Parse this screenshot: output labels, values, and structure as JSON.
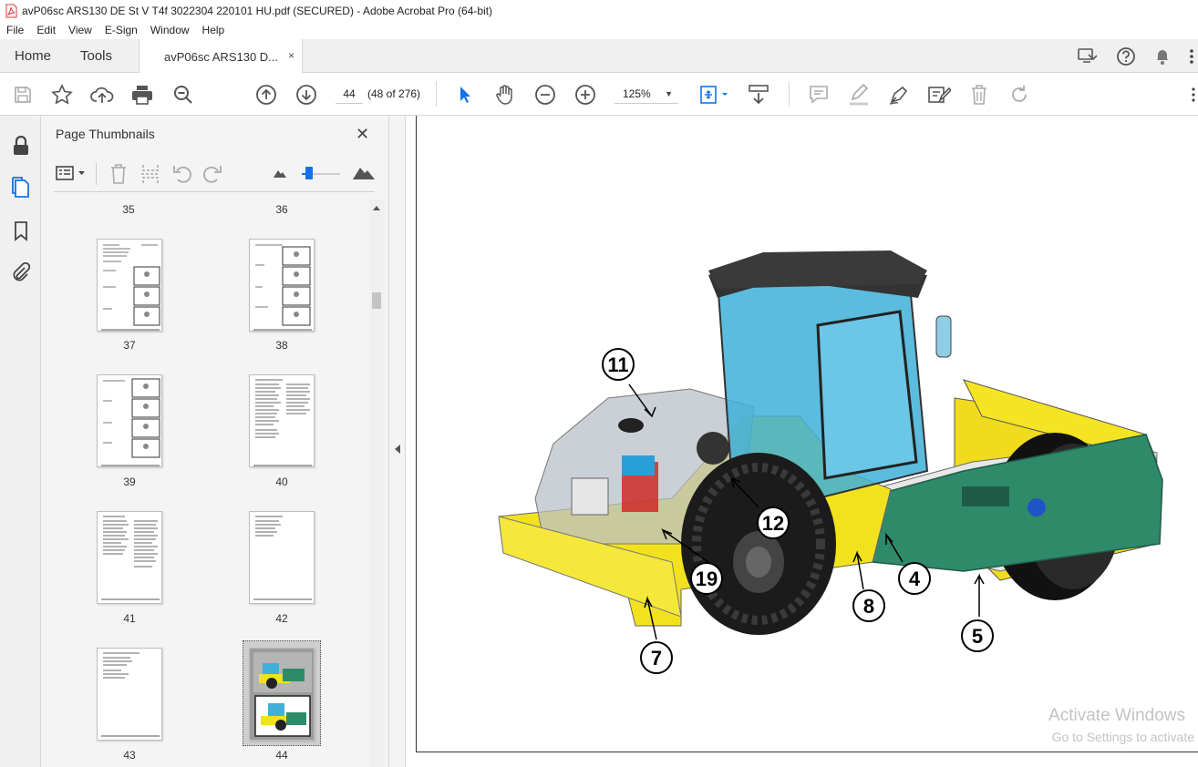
{
  "window": {
    "title": "avP06sc ARS130 DE St V T4f 3022304 220101 HU.pdf (SECURED) - Adobe Acrobat Pro (64-bit)"
  },
  "menu": [
    "File",
    "Edit",
    "View",
    "E-Sign",
    "Window",
    "Help"
  ],
  "tabs": {
    "home": "Home",
    "tools": "Tools",
    "doc": "avP06sc ARS130 D...",
    "close": "×"
  },
  "toolbar": {
    "page_number": "44",
    "page_count": "(48 of 276)",
    "zoom": "125%"
  },
  "panel": {
    "title": "Page Thumbnails",
    "close": "✕"
  },
  "thumbnails": [
    {
      "label": "35"
    },
    {
      "label": "36"
    },
    {
      "label": "37"
    },
    {
      "label": "38"
    },
    {
      "label": "39"
    },
    {
      "label": "40"
    },
    {
      "label": "41"
    },
    {
      "label": "42"
    },
    {
      "label": "43"
    },
    {
      "label": "44"
    }
  ],
  "figure": {
    "callouts": [
      "11",
      "12",
      "19",
      "4",
      "8",
      "5",
      "7"
    ]
  },
  "watermark": {
    "line1": "Activate Windows",
    "line2": "Go to Settings to activate"
  },
  "colors": {
    "accent": "#1473e6",
    "machine_yellow": "#f2e21e",
    "machine_green": "#2e8b6a",
    "cab_blue": "#3fb0d8"
  }
}
